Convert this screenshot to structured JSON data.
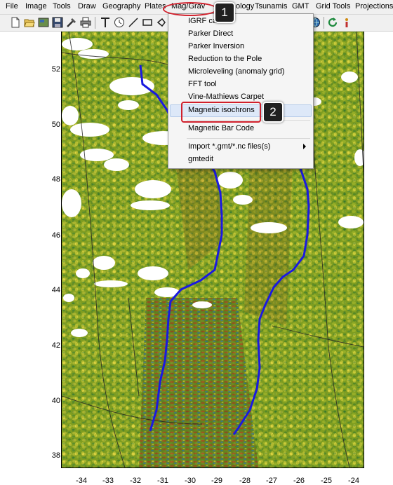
{
  "menubar": {
    "items": [
      "File",
      "Image",
      "Tools",
      "Draw",
      "Geography",
      "Plates",
      "Mag/Grav",
      "ology",
      "Tsunamis",
      "GMT",
      "Grid Tools",
      "Projections"
    ]
  },
  "toolbar": {
    "icons": [
      "new-file-icon",
      "open-folder-icon",
      "image-icon",
      "save-icon",
      "tools-icon",
      "print-icon",
      "text-icon",
      "clock-icon",
      "line-icon",
      "rectangle-icon",
      "globe-icon",
      "refresh-icon",
      "info-icon"
    ]
  },
  "mag_grav_menu": {
    "items": [
      {
        "label": "IGRF calc"
      },
      {
        "label": "Parker Direct"
      },
      {
        "label": "Parker Inversion"
      },
      {
        "label": "Reduction to the Pole"
      },
      {
        "label": "Microleveling (anomaly grid)"
      },
      {
        "label": "FFT tool"
      },
      {
        "label": "Vine-Mathiews Carpet"
      },
      {
        "label": "Magnetic isochrons"
      },
      {
        "label": "Magnetic Bar Code"
      },
      {
        "label": "Import *.gmt/*.nc files(s)"
      },
      {
        "label": "gmtedit"
      }
    ]
  },
  "callouts": {
    "one": "1",
    "two": "2"
  },
  "map": {
    "y_ticks": [
      "52",
      "50",
      "48",
      "46",
      "44",
      "42",
      "40",
      "38"
    ],
    "x_ticks": [
      "-34",
      "-33",
      "-32",
      "-31",
      "-30",
      "-29",
      "-28",
      "-27",
      "-26",
      "-25",
      "-24"
    ],
    "colors": {
      "isochron": "#1a1adf",
      "terrain_base": "#7d9a1f",
      "highlight": "#d0202c"
    }
  }
}
